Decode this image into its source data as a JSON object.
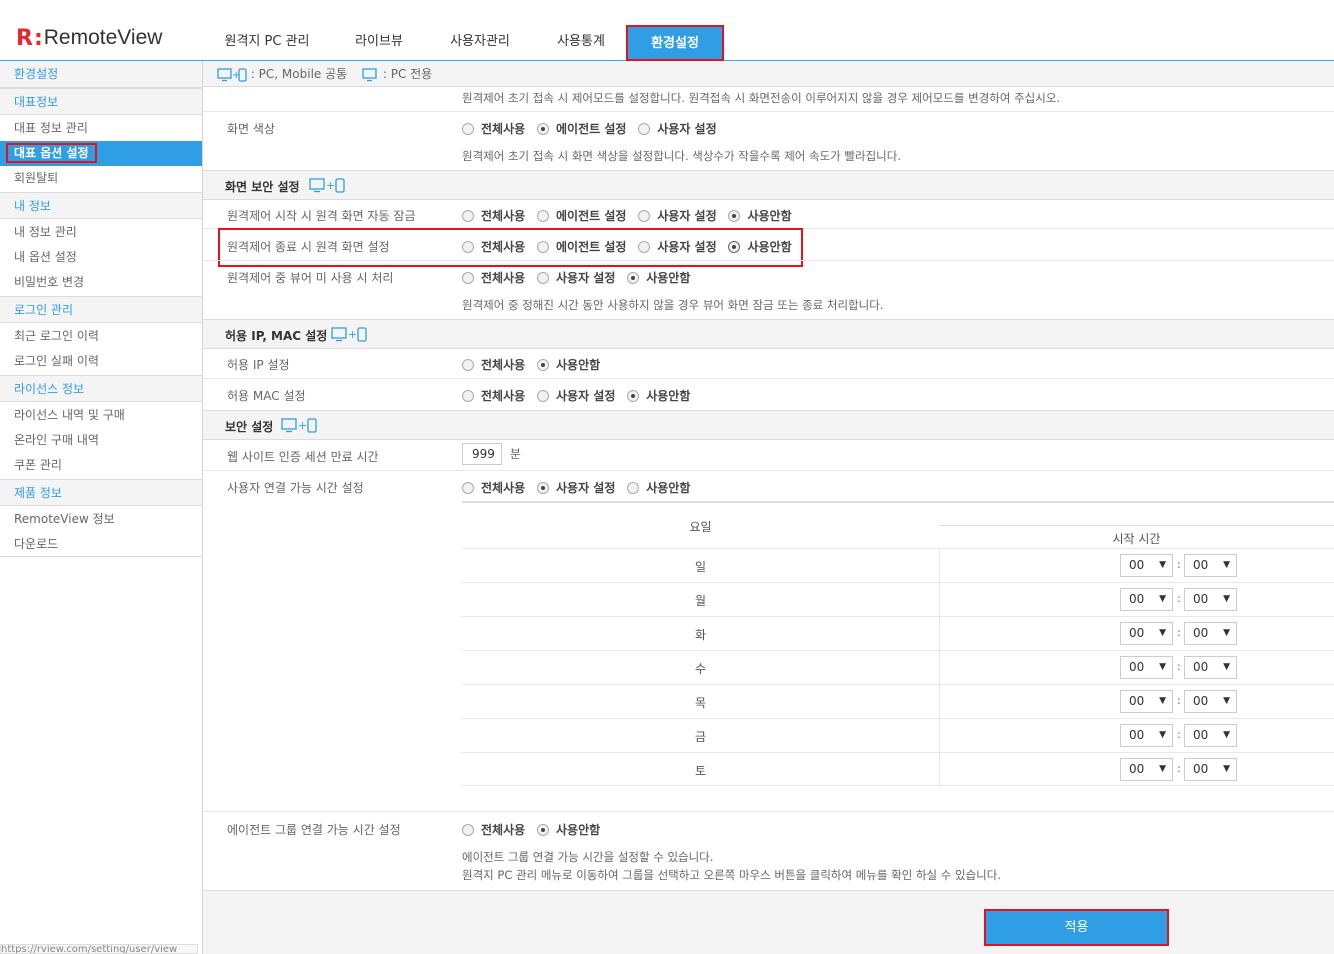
{
  "brand": {
    "name": "RemoteView",
    "mark": "R",
    "colon": ":"
  },
  "nav": {
    "tabs": [
      {
        "label": "원격지 PC 관리"
      },
      {
        "label": "라이브뷰"
      },
      {
        "label": "사용자관리"
      },
      {
        "label": "사용통계"
      },
      {
        "label": "환경설정",
        "active": true
      }
    ]
  },
  "sidebar": {
    "sections": [
      {
        "title": "환경설정"
      },
      {
        "title": "대표정보"
      },
      {
        "title": "내 정보"
      },
      {
        "title": "로그인 관리"
      },
      {
        "title": "라이선스 정보"
      },
      {
        "title": "제품 정보"
      }
    ],
    "items": [
      {
        "label": "대표 정보 관리"
      },
      {
        "label": "대표 옵션 설정",
        "active": true
      },
      {
        "label": "회원탈퇴"
      },
      {
        "label": "내 정보 관리"
      },
      {
        "label": "내 옵션 설정"
      },
      {
        "label": "비밀번호 변경"
      },
      {
        "label": "최근 로그인 이력"
      },
      {
        "label": "로그인 실패 이력"
      },
      {
        "label": "라이선스 내역 및 구매"
      },
      {
        "label": "온라인 구매 내역"
      },
      {
        "label": "쿠폰 관리"
      },
      {
        "label": "RemoteView 정보"
      },
      {
        "label": "다운로드"
      }
    ],
    "status_url": "https://rview.com/setting/user/view"
  },
  "legend": {
    "common": ": PC, Mobile 공통",
    "pc_only": ": PC 전용"
  },
  "content": {
    "top_desc": "원격제어 초기 접속 시 제어모드를 설정합니다. 원격접속 시 화면전송이 이루어지지 않을 경우 제어모드를 변경하여 주십시오.",
    "screen_color": {
      "label": "화면 색상",
      "options": [
        "전체사용",
        "에이전트 설정",
        "사용자 설정"
      ],
      "selected": 1,
      "desc": "원격제어 초기 접속 시 화면 색상을 설정합니다. 색상수가 작을수록 제어 속도가 빨라집니다."
    },
    "screen_security": {
      "title": "화면 보안 설정",
      "auto_lock": {
        "label": "원격제어 시작 시 원격 화면 자동 잠금",
        "options": [
          "전체사용",
          "에이전트 설정",
          "사용자 설정",
          "사용안함"
        ],
        "selected": 3
      },
      "on_end": {
        "label": "원격제어 종료 시 원격 화면 설정",
        "options": [
          "전체사용",
          "에이전트 설정",
          "사용자 설정",
          "사용안함"
        ],
        "selected": 3
      },
      "idle": {
        "label": "원격제어 중 뷰어 미 사용 시 처리",
        "options": [
          "전체사용",
          "사용자 설정",
          "사용안함"
        ],
        "selected": 2,
        "desc": "원격제어 중 정해진 시간 동안 사용하지 않을 경우 뷰어 화면 잠금 또는 종료 처리합니다."
      }
    },
    "allow_ip_mac": {
      "title": "허용 IP, MAC 설정",
      "ip": {
        "label": "허용 IP 설정",
        "options": [
          "전체사용",
          "사용안함"
        ],
        "selected": 1
      },
      "mac": {
        "label": "허용 MAC 설정",
        "options": [
          "전체사용",
          "사용자 설정",
          "사용안함"
        ],
        "selected": 2
      }
    },
    "security": {
      "title": "보안 설정",
      "session": {
        "label": "웹 사이트 인증 세션 만료 시간",
        "value": "999",
        "unit": "분"
      },
      "conn_time": {
        "label": "사용자 연결 가능 시간 설정",
        "options": [
          "전체사용",
          "사용자 설정",
          "사용안함"
        ],
        "selected": 1
      },
      "schedule": {
        "col_day": "요일",
        "col_start": "시작 시간",
        "days": [
          "일",
          "월",
          "화",
          "수",
          "목",
          "금",
          "토"
        ],
        "hour": "00",
        "minute": "00",
        "colon": ":"
      },
      "agent_group": {
        "label": "에이전트 그룹 연결 가능 시간 설정",
        "options": [
          "전체사용",
          "사용안함"
        ],
        "selected": 1,
        "desc1": "에이전트 그룹 연결 가능 시간을 설정할 수 있습니다.",
        "desc2": "원격지 PC 관리 메뉴로 이동하여 그룹을 선택하고 오른쪽 마우스 버튼을 클릭하여 메뉴를 확인 하실 수 있습니다."
      }
    },
    "apply_label": "적용"
  },
  "colors": {
    "accent": "#2f9ee5",
    "highlight": "#e8111b",
    "brand_red": "#e8272d"
  }
}
